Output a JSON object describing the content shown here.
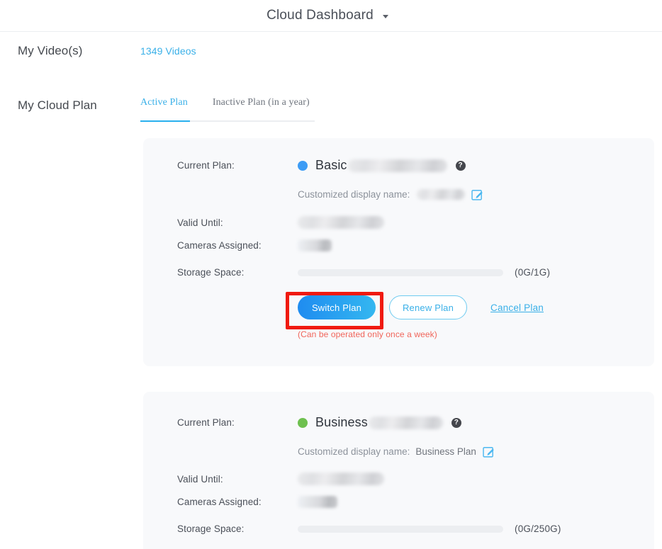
{
  "header": {
    "title": "Cloud Dashboard",
    "dropdown_icon": "chevron-down-icon"
  },
  "sections": {
    "videos": {
      "label": "My Video(s)",
      "link_text": "1349 Videos"
    },
    "cloud_plan": {
      "label": "My Cloud Plan"
    }
  },
  "tabs": [
    {
      "label": "Active Plan",
      "active": true
    },
    {
      "label": "Inactive Plan (in a year)",
      "active": false
    }
  ],
  "field_labels": {
    "current_plan": "Current Plan:",
    "customized_display_name": "Customized display name:",
    "valid_until": "Valid Until:",
    "cameras_assigned": "Cameras Assigned:",
    "storage_space": "Storage Space:"
  },
  "plans": [
    {
      "name": "Basic",
      "dot_color": "#3d9cf5",
      "name_redacted": true,
      "customized_display_name": "",
      "customized_display_name_redacted": true,
      "valid_until": "",
      "valid_until_redacted": true,
      "cameras_assigned": "",
      "cameras_assigned_redacted": true,
      "storage_text": "(0G/1G)",
      "storage_used_percent": 0,
      "help_icon": "help-circle-icon",
      "edit_icon": "edit-pencil-icon",
      "actions": {
        "switch": "Switch Plan",
        "renew": "Renew Plan",
        "cancel": "Cancel Plan",
        "note": "(Can be operated only once a week)"
      }
    },
    {
      "name": "Business",
      "dot_color": "#6ec04f",
      "name_redacted": true,
      "customized_display_name": "Business Plan",
      "customized_display_name_redacted": false,
      "valid_until": "",
      "valid_until_redacted": true,
      "cameras_assigned": "",
      "cameras_assigned_redacted": true,
      "storage_text": "(0G/250G)",
      "storage_used_percent": 0,
      "help_icon": "help-circle-icon",
      "edit_icon": "edit-pencil-icon"
    }
  ],
  "annotation": {
    "highlight_color": "#f01a0f",
    "highlight_target": "switch-plan-button"
  }
}
